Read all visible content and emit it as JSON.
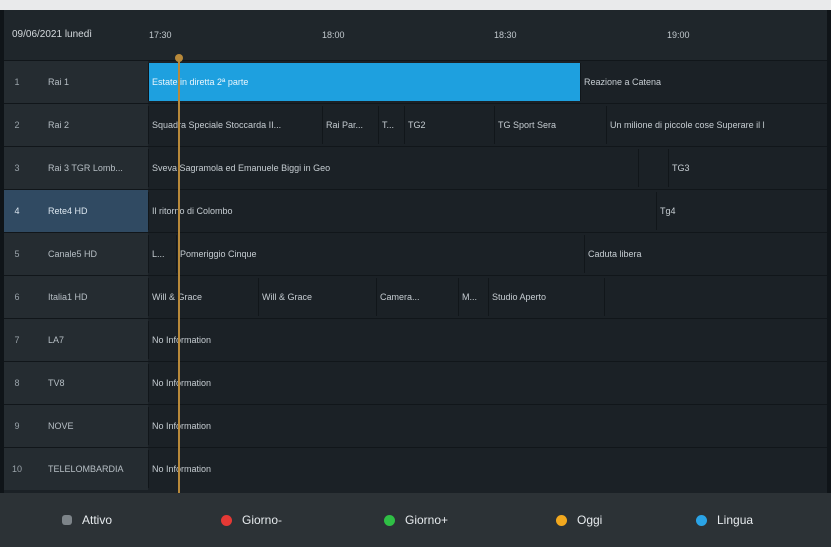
{
  "guide": {
    "date": "09/06/2021 lunedì",
    "times": [
      "17:30",
      "18:00",
      "18:30",
      "19:00"
    ]
  },
  "channels": [
    {
      "num": "1",
      "name": "Rai 1",
      "programs": [
        {
          "title": "Estate in diretta 2ª parte",
          "focus": true
        },
        {
          "title": "Reazione a Catena"
        }
      ]
    },
    {
      "num": "2",
      "name": "Rai 2",
      "programs": [
        {
          "title": "Squadra Speciale Stoccarda II..."
        },
        {
          "title": "Rai Par..."
        },
        {
          "title": "T..."
        },
        {
          "title": "TG2"
        },
        {
          "title": "TG Sport Sera"
        },
        {
          "title": "Un milione di piccole cose Superare il l"
        }
      ]
    },
    {
      "num": "3",
      "name": "Rai 3 TGR Lomb...",
      "programs": [
        {
          "title": "Sveva Sagramola ed Emanuele Biggi in Geo"
        },
        {
          "title": ""
        },
        {
          "title": "TG3"
        }
      ]
    },
    {
      "num": "4",
      "name": "Rete4 HD",
      "selected": true,
      "programs": [
        {
          "title": "Il ritorno di Colombo"
        },
        {
          "title": "Tg4"
        }
      ]
    },
    {
      "num": "5",
      "name": "Canale5 HD",
      "programs": [
        {
          "title": "L..."
        },
        {
          "title": "Pomeriggio Cinque"
        },
        {
          "title": "Caduta libera"
        }
      ]
    },
    {
      "num": "6",
      "name": "Italia1 HD",
      "programs": [
        {
          "title": "Will & Grace"
        },
        {
          "title": "Will & Grace"
        },
        {
          "title": "Camera..."
        },
        {
          "title": "M..."
        },
        {
          "title": "Studio Aperto"
        },
        {
          "title": ""
        }
      ]
    },
    {
      "num": "7",
      "name": "LA7",
      "programs": [
        {
          "title": "No Information"
        }
      ]
    },
    {
      "num": "8",
      "name": "TV8",
      "programs": [
        {
          "title": "No Information"
        }
      ]
    },
    {
      "num": "9",
      "name": "NOVE",
      "programs": [
        {
          "title": "No Information"
        }
      ]
    },
    {
      "num": "10",
      "name": "TELELOMBARDIA",
      "programs": [
        {
          "title": "No Information"
        }
      ]
    }
  ],
  "footer": [
    {
      "label": "Attivo",
      "icon": "square",
      "color": "#7d8489"
    },
    {
      "label": "Giorno-",
      "icon": "dot",
      "color": "#e53935"
    },
    {
      "label": "Giorno+",
      "icon": "dot",
      "color": "#2fbf45"
    },
    {
      "label": "Oggi",
      "icon": "dot",
      "color": "#f2a81e"
    },
    {
      "label": "Lingua",
      "icon": "dot",
      "color": "#2aa3e6"
    }
  ]
}
